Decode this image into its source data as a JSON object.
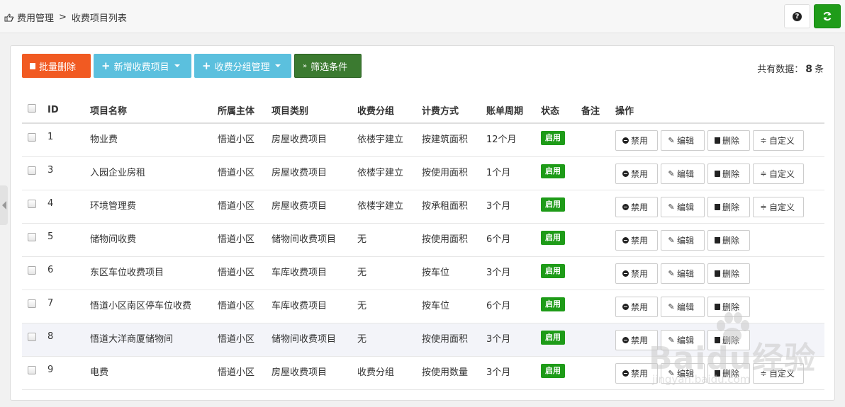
{
  "breadcrumb": {
    "parent": "费用管理",
    "separator": ">",
    "current": "收费项目列表"
  },
  "top_buttons": {
    "help_icon": "question-circle-icon",
    "refresh_icon": "refresh-icon"
  },
  "toolbar": {
    "batch_delete": "批量删除",
    "add_item": "新增收费项目",
    "group_manage": "收费分组管理",
    "filter": "筛选条件"
  },
  "total": {
    "prefix": "共有数据：",
    "count": "8",
    "suffix": "条"
  },
  "table": {
    "headers": [
      "ID",
      "项目名称",
      "所属主体",
      "项目类别",
      "收费分组",
      "计费方式",
      "账单周期",
      "状态",
      "备注",
      "操作"
    ],
    "rows": [
      {
        "id": "1",
        "name": "物业费",
        "owner": "悟道小区",
        "category": "房屋收费项目",
        "group": "依楼宇建立",
        "billing": "按建筑面积",
        "cycle": "12个月",
        "status": "启用",
        "note": "",
        "custom": true
      },
      {
        "id": "3",
        "name": "入园企业房租",
        "owner": "悟道小区",
        "category": "房屋收费项目",
        "group": "依楼宇建立",
        "billing": "按使用面积",
        "cycle": "1个月",
        "status": "启用",
        "note": "",
        "custom": true
      },
      {
        "id": "4",
        "name": "环境管理费",
        "owner": "悟道小区",
        "category": "房屋收费项目",
        "group": "依楼宇建立",
        "billing": "按承租面积",
        "cycle": "3个月",
        "status": "启用",
        "note": "",
        "custom": true
      },
      {
        "id": "5",
        "name": "储物间收费",
        "owner": "悟道小区",
        "category": "储物间收费项目",
        "group": "无",
        "billing": "按使用面积",
        "cycle": "6个月",
        "status": "启用",
        "note": "",
        "custom": false
      },
      {
        "id": "6",
        "name": "东区车位收费项目",
        "owner": "悟道小区",
        "category": "车库收费项目",
        "group": "无",
        "billing": "按车位",
        "cycle": "3个月",
        "status": "启用",
        "note": "",
        "custom": false
      },
      {
        "id": "7",
        "name": "悟道小区南区停车位收费",
        "owner": "悟道小区",
        "category": "车库收费项目",
        "group": "无",
        "billing": "按车位",
        "cycle": "6个月",
        "status": "启用",
        "note": "",
        "custom": false
      },
      {
        "id": "8",
        "name": "悟道大洋商厦储物间",
        "owner": "悟道小区",
        "category": "储物间收费项目",
        "group": "无",
        "billing": "按使用面积",
        "cycle": "3个月",
        "status": "启用",
        "note": "",
        "custom": false
      },
      {
        "id": "9",
        "name": "电费",
        "owner": "悟道小区",
        "category": "房屋收费项目",
        "group": "收费分组",
        "billing": "按使用数量",
        "cycle": "3个月",
        "status": "启用",
        "note": "",
        "custom": true
      }
    ],
    "actions": {
      "disable": "禁用",
      "edit": "编辑",
      "delete": "删除",
      "custom": "自定义"
    }
  },
  "watermark": {
    "brand": "Baidu经验",
    "site": "jingyan.baidu.com"
  },
  "colors": {
    "danger": "#f15a22",
    "info": "#5bc0de",
    "success": "#1f9c19",
    "filter": "#3b7a30"
  }
}
